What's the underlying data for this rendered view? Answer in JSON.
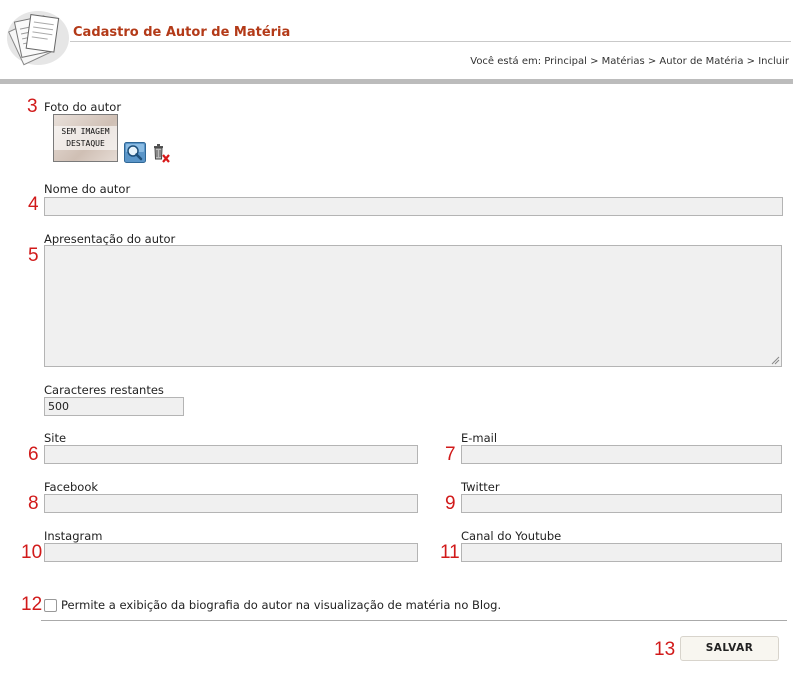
{
  "header": {
    "title": "Cadastro de Autor de Matéria",
    "breadcrumb": "Você está em: Principal > Matérias > Autor de Matéria > Incluir"
  },
  "form": {
    "photo": {
      "num": "3",
      "label": "Foto do autor",
      "placeholder_line1": "SEM IMAGEM",
      "placeholder_line2": "DESTAQUE"
    },
    "name": {
      "num": "4",
      "label": "Nome do autor",
      "value": ""
    },
    "bio": {
      "num": "5",
      "label": "Apresentação do autor",
      "value": ""
    },
    "chars": {
      "label": "Caracteres restantes",
      "value": "500"
    },
    "site": {
      "num": "6",
      "label": "Site",
      "value": ""
    },
    "email": {
      "num": "7",
      "label": "E-mail",
      "value": ""
    },
    "facebook": {
      "num": "8",
      "label": "Facebook",
      "value": ""
    },
    "twitter": {
      "num": "9",
      "label": "Twitter",
      "value": ""
    },
    "instagram": {
      "num": "10",
      "label": "Instagram",
      "value": ""
    },
    "youtube": {
      "num": "11",
      "label": "Canal do Youtube",
      "value": ""
    },
    "allow_bio": {
      "num": "12",
      "label": "Permite a exibição da biografia do autor na visualização de matéria no Blog.",
      "checked": false
    },
    "save": {
      "num": "13",
      "label": "SALVAR"
    }
  },
  "colors": {
    "title": "#b33a18",
    "annotation": "#d11a1a",
    "field_bg": "#f0f0f0"
  },
  "icons": [
    "papers-logo-icon",
    "magnifier-icon",
    "trash-delete-icon"
  ]
}
